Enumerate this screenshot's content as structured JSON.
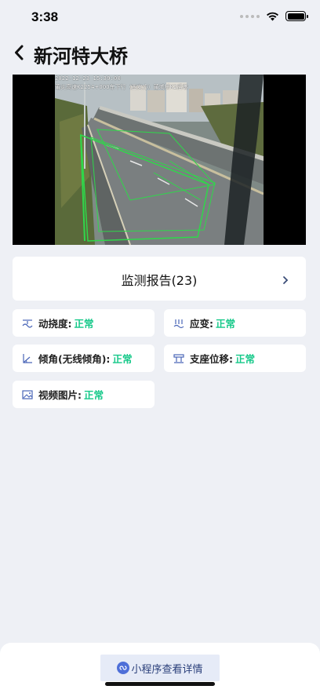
{
  "status_bar": {
    "time": "3:38"
  },
  "header": {
    "title": "新河特大桥"
  },
  "video": {
    "timestamp": "2022-12-23 15:39:00",
    "caption": "莆炎高速K2254+000东下行（西安方）莆城桥K2后墩"
  },
  "report": {
    "label": "监测报告(23)"
  },
  "metrics": [
    {
      "icon": "dynamic-deflection-icon",
      "label": "动挠度:",
      "value": "正常"
    },
    {
      "icon": "strain-icon",
      "label": "应变:",
      "value": "正常"
    },
    {
      "icon": "tilt-icon",
      "label": "倾角(无线倾角):",
      "value": "正常"
    },
    {
      "icon": "bearing-icon",
      "label": "支座位移:",
      "value": "正常"
    },
    {
      "icon": "video-image-icon",
      "label": "视频图片:",
      "value": "正常"
    }
  ],
  "bottom": {
    "button_label": "小程序查看详情"
  },
  "colors": {
    "ok": "#17c98a",
    "accent": "#4e6fd8",
    "background": "#eef0f5"
  }
}
